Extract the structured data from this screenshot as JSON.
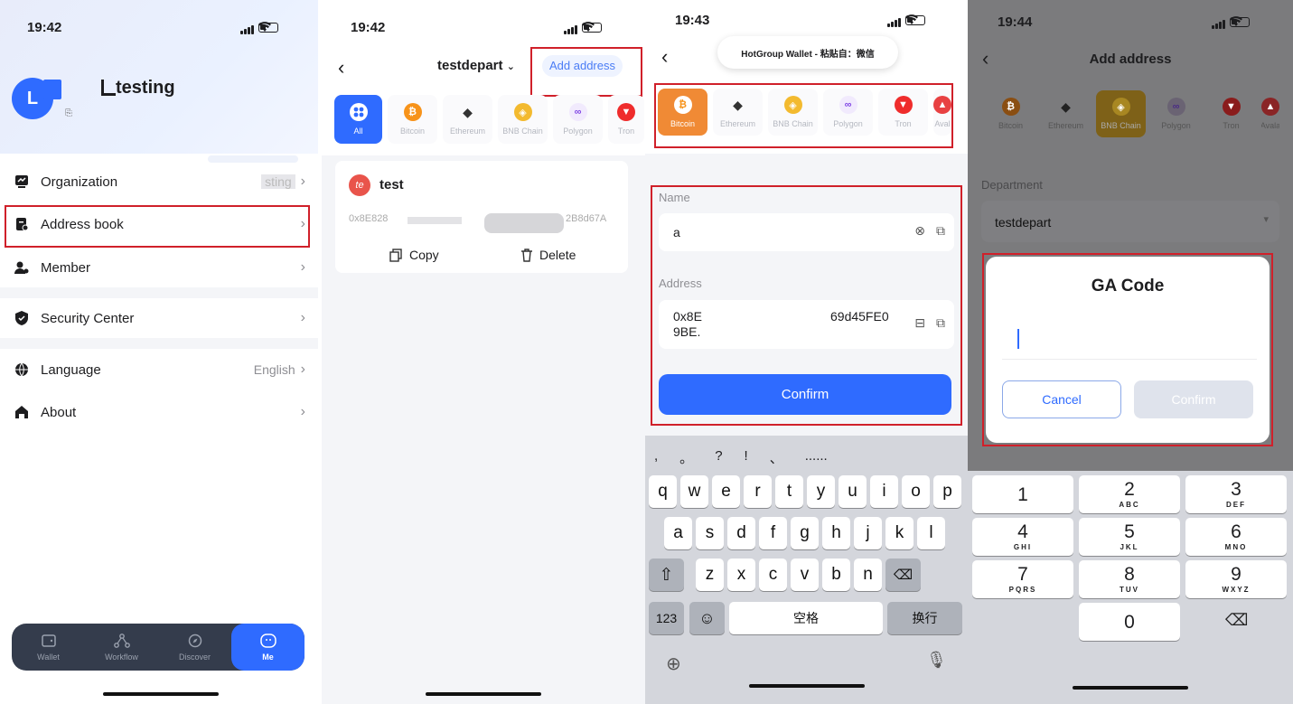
{
  "p1": {
    "time": "19:42",
    "avatar_letter": "L",
    "org_name": "testing",
    "menu": [
      {
        "label": "Organization",
        "value": "sting",
        "icon": "organization-icon"
      },
      {
        "label": "Address book",
        "value": "",
        "icon": "address-book-icon"
      },
      {
        "label": "Member",
        "value": "",
        "icon": "member-icon"
      },
      {
        "label": "Security Center",
        "value": "",
        "icon": "shield-icon"
      },
      {
        "label": "Language",
        "value": "English",
        "icon": "globe-icon"
      },
      {
        "label": "About",
        "value": "",
        "icon": "home-icon"
      }
    ],
    "tabs": [
      {
        "label": "Wallet",
        "icon": "wallet-icon"
      },
      {
        "label": "Workflow",
        "icon": "workflow-icon"
      },
      {
        "label": "Discover",
        "icon": "compass-icon"
      },
      {
        "label": "Me",
        "icon": "me-icon"
      }
    ]
  },
  "p2": {
    "time": "19:42",
    "title": "testdepart",
    "add_address": "Add address",
    "coins": [
      "All",
      "Bitcoin",
      "Ethereum",
      "BNB Chain",
      "Polygon",
      "Tron"
    ],
    "entry": {
      "badge": "te",
      "name": "test",
      "addr_start": "0x8E828",
      "addr_end": "2B8d67A",
      "copy": "Copy",
      "delete": "Delete"
    }
  },
  "p3": {
    "time": "19:43",
    "banner": "HotGroup Wallet - 粘贴自：微信",
    "coins": [
      "Bitcoin",
      "Ethereum",
      "BNB Chain",
      "Polygon",
      "Tron",
      "Aval"
    ],
    "name_label": "Name",
    "name_value": "a",
    "address_label": "Address",
    "address_line1_a": "0x8E",
    "address_line1_b": "69d45FE0",
    "address_line2": "9BE.",
    "confirm": "Confirm",
    "punct": [
      ",",
      "。",
      "?",
      "!",
      "、",
      "......"
    ],
    "row1": [
      "q",
      "w",
      "e",
      "r",
      "t",
      "y",
      "u",
      "i",
      "o",
      "p"
    ],
    "row2": [
      "a",
      "s",
      "d",
      "f",
      "g",
      "h",
      "j",
      "k",
      "l"
    ],
    "row3": [
      "z",
      "x",
      "c",
      "v",
      "b",
      "n",
      "m"
    ],
    "key_123": "123",
    "key_space": "空格",
    "key_return": "换行"
  },
  "p4": {
    "time": "19:44",
    "title": "Add address",
    "coins": [
      "Bitcoin",
      "Ethereum",
      "BNB Chain",
      "Polygon",
      "Tron",
      "Avala"
    ],
    "department_label": "Department",
    "department_value": "testdepart",
    "dialog_title": "GA Code",
    "cancel": "Cancel",
    "confirm": "Confirm",
    "keys": [
      {
        "d": "1",
        "l": ""
      },
      {
        "d": "2",
        "l": "ABC"
      },
      {
        "d": "3",
        "l": "DEF"
      },
      {
        "d": "4",
        "l": "GHI"
      },
      {
        "d": "5",
        "l": "JKL"
      },
      {
        "d": "6",
        "l": "MNO"
      },
      {
        "d": "7",
        "l": "PQRS"
      },
      {
        "d": "8",
        "l": "TUV"
      },
      {
        "d": "9",
        "l": "WXYZ"
      },
      {
        "d": "0",
        "l": ""
      }
    ]
  },
  "colors": {
    "accent": "#2f6bff",
    "highlight": "#d0202a",
    "bitcoin": "#f7931a",
    "bnb": "#f3ba2f",
    "polygon": "#8247e5",
    "tron": "#ef2c2c"
  }
}
